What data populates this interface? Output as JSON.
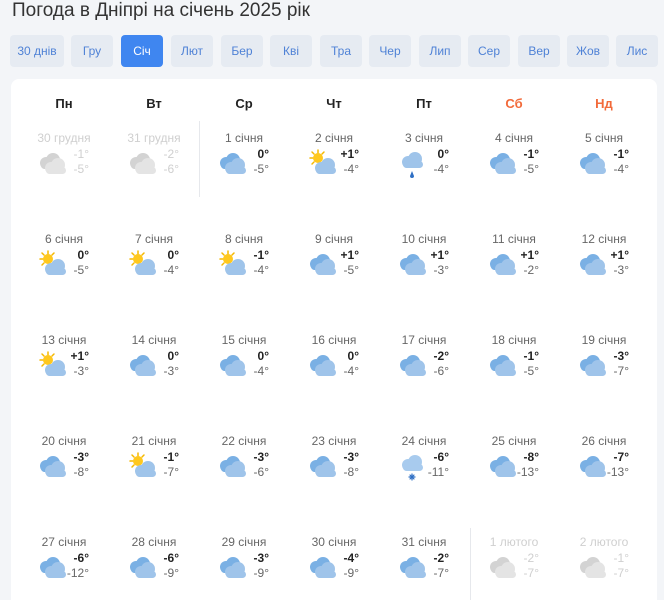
{
  "page_title": "Погода в Дніпрі на січень 2025 рік",
  "months": [
    "30 днів",
    "Гру",
    "Січ",
    "Лют",
    "Бер",
    "Кві",
    "Тра",
    "Чер",
    "Лип",
    "Сер",
    "Вер",
    "Жов",
    "Лис"
  ],
  "active_month_index": 2,
  "weekdays": [
    "Пн",
    "Вт",
    "Ср",
    "Чт",
    "Пт",
    "Сб",
    "Нд"
  ],
  "weekend_color": "#f26a3a",
  "accent_color": "#3f86f0",
  "days": [
    {
      "date": "30 грудня",
      "hi": "-1°",
      "lo": "-5°",
      "icon": "cloud-icon",
      "faded": true
    },
    {
      "date": "31 грудня",
      "hi": "-2°",
      "lo": "-6°",
      "icon": "cloud-icon",
      "faded": true
    },
    {
      "date": "1 січня",
      "hi": "0°",
      "lo": "-5°",
      "icon": "cloudy-icon",
      "faded": false
    },
    {
      "date": "2 січня",
      "hi": "+1°",
      "lo": "-4°",
      "icon": "partly-sunny-icon",
      "faded": false
    },
    {
      "date": "3 січня",
      "hi": "0°",
      "lo": "-4°",
      "icon": "rain-icon",
      "faded": false
    },
    {
      "date": "4 січня",
      "hi": "-1°",
      "lo": "-5°",
      "icon": "cloudy-icon",
      "faded": false
    },
    {
      "date": "5 січня",
      "hi": "-1°",
      "lo": "-4°",
      "icon": "cloudy-icon",
      "faded": false
    },
    {
      "date": "6 січня",
      "hi": "0°",
      "lo": "-5°",
      "icon": "partly-sunny-icon",
      "faded": false
    },
    {
      "date": "7 січня",
      "hi": "0°",
      "lo": "-4°",
      "icon": "partly-sunny-icon",
      "faded": false
    },
    {
      "date": "8 січня",
      "hi": "-1°",
      "lo": "-4°",
      "icon": "partly-sunny-icon",
      "faded": false
    },
    {
      "date": "9 січня",
      "hi": "+1°",
      "lo": "-5°",
      "icon": "cloudy-icon",
      "faded": false
    },
    {
      "date": "10 січня",
      "hi": "+1°",
      "lo": "-3°",
      "icon": "cloudy-icon",
      "faded": false
    },
    {
      "date": "11 січня",
      "hi": "+1°",
      "lo": "-2°",
      "icon": "cloudy-icon",
      "faded": false
    },
    {
      "date": "12 січня",
      "hi": "+1°",
      "lo": "-3°",
      "icon": "cloudy-icon",
      "faded": false
    },
    {
      "date": "13 січня",
      "hi": "+1°",
      "lo": "-3°",
      "icon": "partly-sunny-icon",
      "faded": false
    },
    {
      "date": "14 січня",
      "hi": "0°",
      "lo": "-3°",
      "icon": "cloudy-icon",
      "faded": false
    },
    {
      "date": "15 січня",
      "hi": "0°",
      "lo": "-4°",
      "icon": "cloudy-icon",
      "faded": false
    },
    {
      "date": "16 січня",
      "hi": "0°",
      "lo": "-4°",
      "icon": "cloudy-icon",
      "faded": false
    },
    {
      "date": "17 січня",
      "hi": "-2°",
      "lo": "-6°",
      "icon": "cloudy-icon",
      "faded": false
    },
    {
      "date": "18 січня",
      "hi": "-1°",
      "lo": "-5°",
      "icon": "cloudy-icon",
      "faded": false
    },
    {
      "date": "19 січня",
      "hi": "-3°",
      "lo": "-7°",
      "icon": "cloudy-icon",
      "faded": false
    },
    {
      "date": "20 січня",
      "hi": "-3°",
      "lo": "-8°",
      "icon": "cloudy-icon",
      "faded": false
    },
    {
      "date": "21 січня",
      "hi": "-1°",
      "lo": "-7°",
      "icon": "partly-sunny-icon",
      "faded": false
    },
    {
      "date": "22 січня",
      "hi": "-3°",
      "lo": "-6°",
      "icon": "cloudy-icon",
      "faded": false
    },
    {
      "date": "23 січня",
      "hi": "-3°",
      "lo": "-8°",
      "icon": "cloudy-icon",
      "faded": false
    },
    {
      "date": "24 січня",
      "hi": "-6°",
      "lo": "-11°",
      "icon": "snow-icon",
      "faded": false
    },
    {
      "date": "25 січня",
      "hi": "-8°",
      "lo": "-13°",
      "icon": "cloudy-icon",
      "faded": false
    },
    {
      "date": "26 січня",
      "hi": "-7°",
      "lo": "-13°",
      "icon": "cloudy-icon",
      "faded": false
    },
    {
      "date": "27 січня",
      "hi": "-6°",
      "lo": "-12°",
      "icon": "cloudy-icon",
      "faded": false
    },
    {
      "date": "28 січня",
      "hi": "-6°",
      "lo": "-9°",
      "icon": "cloudy-icon",
      "faded": false
    },
    {
      "date": "29 січня",
      "hi": "-3°",
      "lo": "-9°",
      "icon": "cloudy-icon",
      "faded": false
    },
    {
      "date": "30 січня",
      "hi": "-4°",
      "lo": "-9°",
      "icon": "cloudy-icon",
      "faded": false
    },
    {
      "date": "31 січня",
      "hi": "-2°",
      "lo": "-7°",
      "icon": "cloudy-icon",
      "faded": false
    },
    {
      "date": "1 лютого",
      "hi": "-2°",
      "lo": "-7°",
      "icon": "cloud-icon",
      "faded": true
    },
    {
      "date": "2 лютого",
      "hi": "-1°",
      "lo": "-7°",
      "icon": "cloud-icon",
      "faded": true
    }
  ]
}
